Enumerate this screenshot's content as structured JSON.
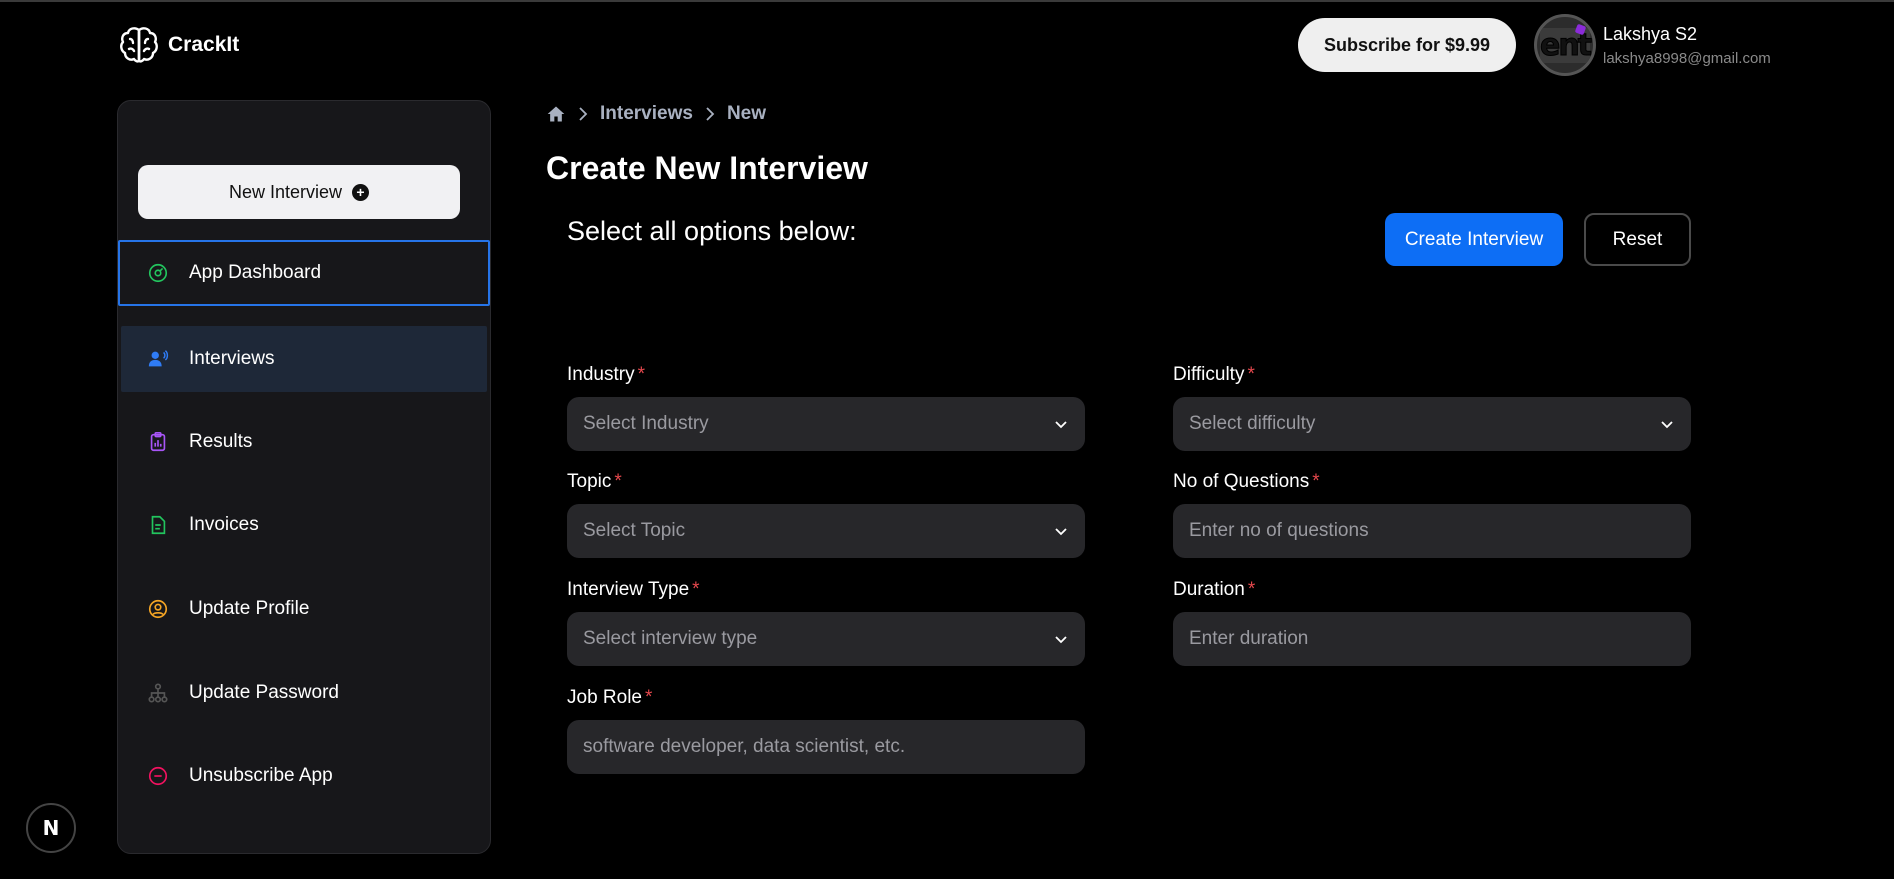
{
  "app": {
    "name": "CrackIt"
  },
  "header": {
    "subscribe_label": "Subscribe for $9.99",
    "avatar_text": "ent",
    "user_name": "Lakshya S2",
    "user_email": "lakshya8998@gmail.com"
  },
  "sidebar": {
    "new_interview_label": "New Interview",
    "items": [
      {
        "label": "App Dashboard",
        "icon": "dashboard-icon",
        "color": "#22c55e"
      },
      {
        "label": "Interviews",
        "icon": "users-icon",
        "color": "#2f7cf6"
      },
      {
        "label": "Results",
        "icon": "clipboard-chart-icon",
        "color": "#a855f7"
      },
      {
        "label": "Invoices",
        "icon": "document-icon",
        "color": "#22c55e"
      },
      {
        "label": "Update Profile",
        "icon": "user-circle-icon",
        "color": "#f5a524"
      },
      {
        "label": "Update Password",
        "icon": "hierarchy-icon",
        "color": "#555555"
      },
      {
        "label": "Unsubscribe App",
        "icon": "minus-circle-icon",
        "color": "#f31260"
      }
    ]
  },
  "breadcrumb": {
    "items": [
      "Interviews",
      "New"
    ]
  },
  "main": {
    "title": "Create New Interview",
    "subtitle": "Select all options below:",
    "create_label": "Create Interview",
    "reset_label": "Reset"
  },
  "form": {
    "industry": {
      "label": "Industry",
      "placeholder": "Select Industry"
    },
    "difficulty": {
      "label": "Difficulty",
      "placeholder": "Select difficulty"
    },
    "topic": {
      "label": "Topic",
      "placeholder": "Select Topic"
    },
    "num_questions": {
      "label": "No of Questions",
      "placeholder": "Enter no of questions"
    },
    "interview_type": {
      "label": "Interview Type",
      "placeholder": "Select interview type"
    },
    "duration": {
      "label": "Duration",
      "placeholder": "Enter duration"
    },
    "job_role": {
      "label": "Job Role",
      "placeholder": "software developer, data scientist, etc."
    },
    "required_mark": "*"
  },
  "dev_badge": "N",
  "colors": {
    "accent": "#0d6ef5",
    "focus_border": "#2674e8",
    "required": "#e5484d"
  }
}
